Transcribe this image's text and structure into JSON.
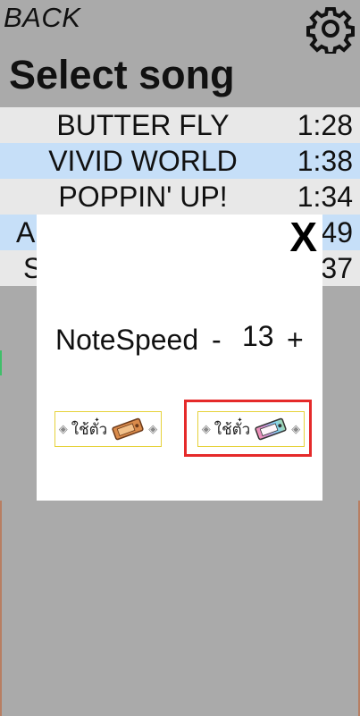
{
  "header": {
    "back_label": "BACK",
    "settings_icon": "gear-icon",
    "title": "Select song"
  },
  "songs": [
    {
      "name": "BUTTER FLY",
      "time": "1:28",
      "style": "light"
    },
    {
      "name": "VIVID WORLD",
      "time": "1:38",
      "style": "blue"
    },
    {
      "name": "POPPIN' UP!",
      "time": "1:34",
      "style": "light"
    },
    {
      "name": "A",
      "time": "49",
      "style": "blue"
    },
    {
      "name": "S",
      "time": "37",
      "style": "light"
    }
  ],
  "dialog": {
    "close_label": "X",
    "notespeed_label": "NoteSpeed",
    "decrement_label": "-",
    "value": "13",
    "increment_label": "+",
    "ticket_buttons": [
      {
        "label": "ใช้ตั๋ว",
        "icon": "orange-ticket-icon"
      },
      {
        "label": "ใช้ตั๋ว",
        "icon": "rainbow-ticket-icon"
      }
    ]
  },
  "colors": {
    "background": "#aaaaaa",
    "row_light": "#e8e8e8",
    "row_blue": "#c6dff8",
    "highlight": "#e52a2a"
  }
}
